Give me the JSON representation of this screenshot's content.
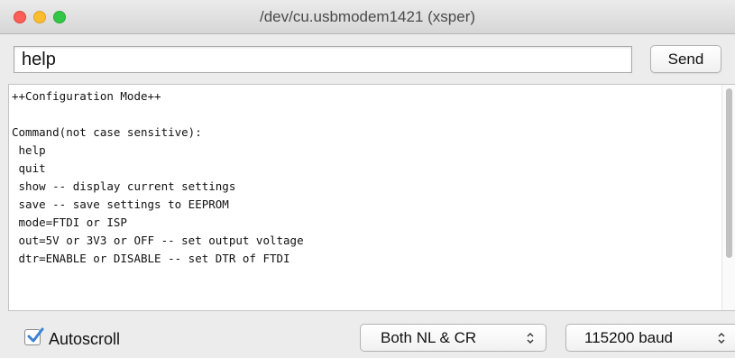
{
  "window": {
    "title": "/dev/cu.usbmodem1421 (xsper)",
    "colors": {
      "close": "#fc5f57",
      "minimize": "#fdbc2e",
      "zoom": "#33c748"
    }
  },
  "input": {
    "value": "help",
    "send_label": "Send"
  },
  "console": {
    "lines": [
      "++Configuration Mode++",
      "",
      "Command(not case sensitive):",
      " help",
      " quit",
      " show -- display current settings",
      " save -- save settings to EEPROM",
      " mode=FTDI or ISP",
      " out=5V or 3V3 or OFF -- set output voltage",
      " dtr=ENABLE or DISABLE -- set DTR of FTDI"
    ]
  },
  "footer": {
    "autoscroll_label": "Autoscroll",
    "autoscroll_checked": true,
    "line_ending": "Both NL & CR",
    "baud_rate": "115200 baud",
    "accent_color": "#3b82d6"
  },
  "icons": [
    "checkmark-icon",
    "stepper-arrows-icon"
  ]
}
